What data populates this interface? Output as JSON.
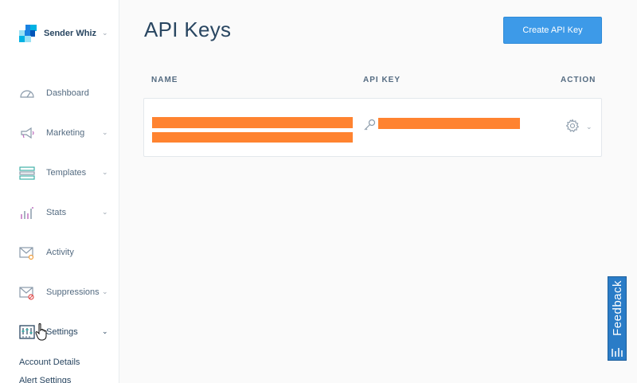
{
  "brand": {
    "name": "Sender Whiz"
  },
  "sidebar": {
    "items": [
      {
        "label": "Dashboard",
        "icon": "dashboard-icon",
        "has_chevron": false
      },
      {
        "label": "Marketing",
        "icon": "megaphone-icon",
        "has_chevron": true
      },
      {
        "label": "Templates",
        "icon": "templates-icon",
        "has_chevron": true
      },
      {
        "label": "Stats",
        "icon": "stats-icon",
        "has_chevron": true
      },
      {
        "label": "Activity",
        "icon": "activity-icon",
        "has_chevron": false
      },
      {
        "label": "Suppressions",
        "icon": "suppressions-icon",
        "has_chevron": true
      },
      {
        "label": "Settings",
        "icon": "settings-icon",
        "has_chevron": true
      }
    ],
    "settings_subitems": [
      "Account Details",
      "Alert Settings"
    ]
  },
  "main": {
    "title": "API Keys",
    "create_button": "Create API Key",
    "columns": [
      "NAME",
      "API KEY",
      "ACTION"
    ]
  },
  "feedback": {
    "label": "Feedback"
  },
  "colors": {
    "accent": "#3d9ae8",
    "redaction": "#ff8330",
    "feedback": "#2a7cc7"
  }
}
